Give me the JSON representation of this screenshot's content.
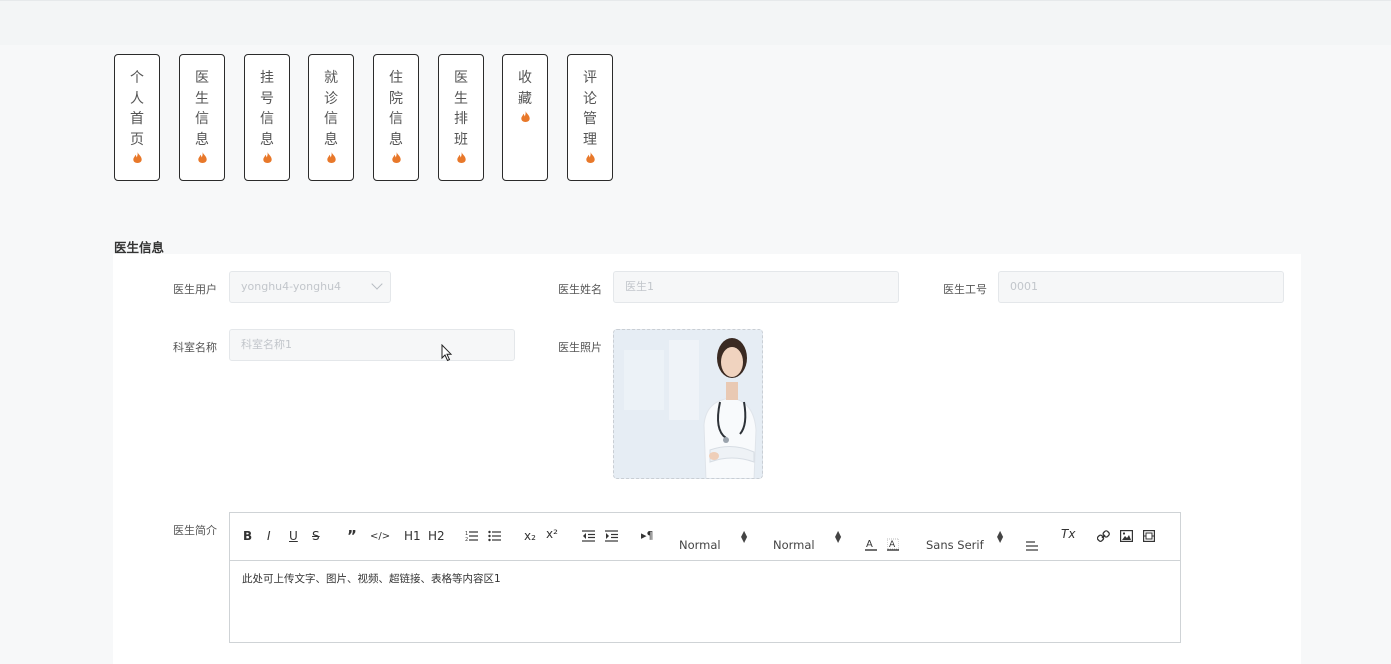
{
  "tabs": [
    {
      "label": "个人首页",
      "chars": [
        "个",
        "人",
        "首",
        "页"
      ]
    },
    {
      "label": "医生信息",
      "chars": [
        "医",
        "生",
        "信",
        "息"
      ]
    },
    {
      "label": "挂号信息",
      "chars": [
        "挂",
        "号",
        "信",
        "息"
      ]
    },
    {
      "label": "就诊信息",
      "chars": [
        "就",
        "诊",
        "信",
        "息"
      ]
    },
    {
      "label": "住院信息",
      "chars": [
        "住",
        "院",
        "信",
        "息"
      ]
    },
    {
      "label": "医生排班",
      "chars": [
        "医",
        "生",
        "排",
        "班"
      ]
    },
    {
      "label": "收藏",
      "chars": [
        "收",
        "藏"
      ]
    },
    {
      "label": "评论管理",
      "chars": [
        "评",
        "论",
        "管",
        "理"
      ]
    }
  ],
  "tab_icon": "flame-icon",
  "tab_icon_color": "#e8782a",
  "section_title": "医生信息",
  "form": {
    "doctor_user": {
      "label": "医生用户",
      "value": "yonghu4-yonghu4"
    },
    "doctor_name": {
      "label": "医生姓名",
      "value": "医生1"
    },
    "employee_no": {
      "label": "医生工号",
      "value": "0001"
    },
    "department": {
      "label": "科室名称",
      "value": "科室名称1"
    },
    "photo": {
      "label": "医生照片"
    },
    "intro": {
      "label": "医生简介",
      "content": "此处可上传文字、图片、视频、超链接、表格等内容区1"
    }
  },
  "toolbar": {
    "bold": "B",
    "italic": "I",
    "underline": "U",
    "strike": "S",
    "quote": "”",
    "code": "</>",
    "h1": "H1",
    "h2": "H2",
    "sub": "x₂",
    "sup": "x²",
    "rtl": "▸¶",
    "size": "Normal",
    "header": "Normal",
    "font": "Sans Serif",
    "clean": "Tx"
  }
}
